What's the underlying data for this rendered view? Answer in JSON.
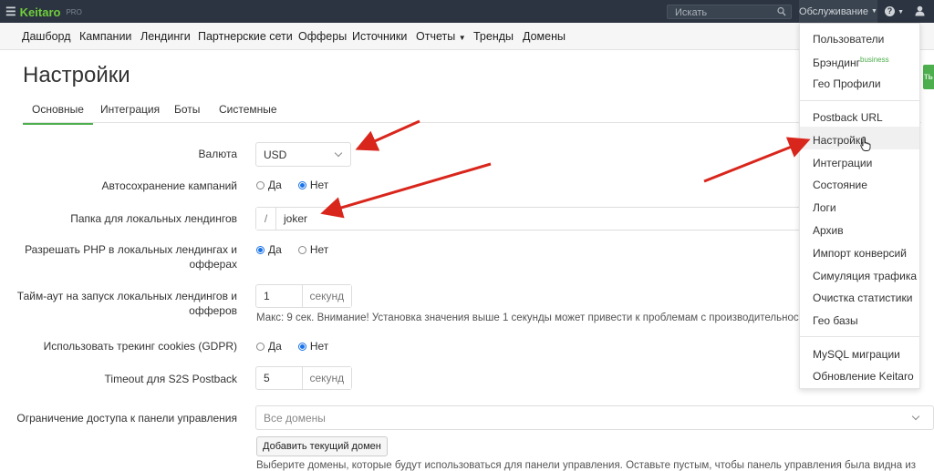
{
  "topbar": {
    "brand": "Keitaro",
    "brand_badge": "PRO",
    "search_placeholder": "Искать",
    "maintenance_label": "Обслуживание",
    "help_label": "?"
  },
  "nav": {
    "items": [
      "Дашборд",
      "Кампании",
      "Лендинги",
      "Партнерские сети",
      "Офферы",
      "Источники",
      "Отчеты",
      "Тренды",
      "Домены"
    ]
  },
  "page": {
    "title": "Настройки",
    "save_label": "ть"
  },
  "tabs": [
    "Основные",
    "Интеграция",
    "Боты",
    "Системные"
  ],
  "form": {
    "currency": {
      "label": "Валюта",
      "value": "USD"
    },
    "autosave": {
      "label": "Автосохранение кампаний",
      "options": [
        "Да",
        "Нет"
      ],
      "selected": "Нет"
    },
    "landing_folder": {
      "label": "Папка для локальных лендингов",
      "prefix": "/",
      "value": "joker"
    },
    "allow_php": {
      "label_line1": "Разрешать PHP в локальных лендингах и",
      "label_line2": "офферах",
      "options": [
        "Да",
        "Нет"
      ],
      "selected": "Да"
    },
    "timeout_landing": {
      "label_line1": "Тайм-аут на запуск локальных лендингов и",
      "label_line2": "офферов",
      "value": "1",
      "unit": "секунд",
      "hint": "Макс: 9 сек. Внимание! Установка значения выше 1 секунды может привести к проблемам с производительност"
    },
    "gdpr": {
      "label": "Использовать трекинг cookies (GDPR)",
      "options": [
        "Да",
        "Нет"
      ],
      "selected": "Нет"
    },
    "s2s_timeout": {
      "label": "Timeout для S2S Postback",
      "value": "5",
      "unit": "секунд"
    },
    "access": {
      "label": "Ограничение доступа к панели управления",
      "placeholder": "Все домены",
      "add_button": "Добавить текущий домен",
      "hint": "Выберите домены, которые будут использоваться для панели управления. Оставьте пустым, чтобы панель управления была видна из"
    }
  },
  "dropdown": {
    "group1": [
      "Пользователи",
      "Брэндинг",
      "Гео Профили"
    ],
    "branding_badge": "business",
    "group2": [
      "Postback URL",
      "Настройки",
      "Интеграции",
      "Состояние",
      "Логи",
      "Архив",
      "Импорт конверсий",
      "Симуляция трафика",
      "Очистка статистики",
      "Гео базы"
    ],
    "group3": [
      "MySQL миграции",
      "Обновление Keitaro"
    ]
  },
  "colors": {
    "topbar_bg": "#2b3440",
    "brand_green": "#6fce3b",
    "accent_green": "#4cae4c",
    "radio_blue": "#1a73e8",
    "annotation_red": "#d9261c"
  }
}
